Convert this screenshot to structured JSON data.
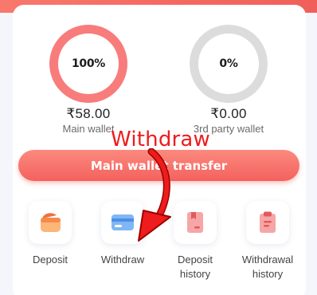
{
  "wallets": {
    "main": {
      "percent_label": "100%",
      "percent": 100,
      "amount": "₹58.00",
      "label": "Main wallet",
      "color": "#f87c7c"
    },
    "third_party": {
      "percent_label": "0%",
      "percent": 0,
      "amount": "₹0.00",
      "label": "3rd party wallet",
      "color": "#dcdcdc"
    }
  },
  "annotation": {
    "text": "Withdraw",
    "color": "#ee1c1c"
  },
  "transfer_button": {
    "label": "Main wallet transfer"
  },
  "actions": [
    {
      "id": "deposit",
      "label": "Deposit",
      "icon": "wallet-icon"
    },
    {
      "id": "withdraw",
      "label": "Withdraw",
      "icon": "card-icon"
    },
    {
      "id": "deposit-history",
      "label": "Deposit\nhistory",
      "icon": "document-icon"
    },
    {
      "id": "withdrawal-history",
      "label": "Withdrawal\nhistory",
      "icon": "clipboard-icon"
    }
  ],
  "colors": {
    "accent": "#f4615e",
    "background": "#f4f6fc"
  }
}
